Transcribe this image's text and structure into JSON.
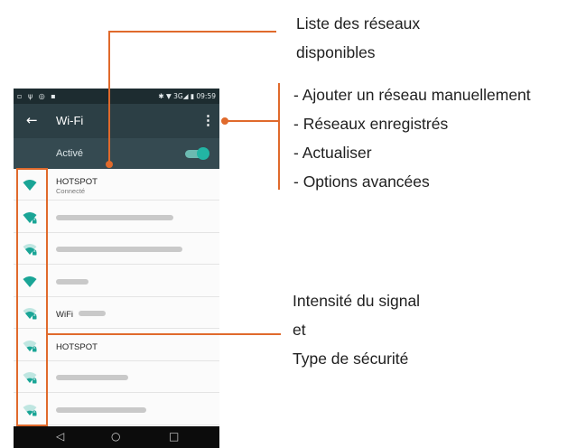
{
  "status_bar": {
    "left_icons": "▫ ψ ◎ ▪",
    "right": "✱ ▼ 3G◢ ▮ 09:59"
  },
  "app_bar": {
    "back_icon": "←",
    "title": "Wi-Fi",
    "menu_icon": "⋮"
  },
  "toggle_row": {
    "label": "Activé",
    "state": "on"
  },
  "networks": [
    {
      "name": "HOTSPOT",
      "sub": "Connecté",
      "signal": "full",
      "secured": false
    },
    {
      "name": "",
      "signal": "full",
      "secured": true
    },
    {
      "name": "",
      "signal": "medium",
      "secured": true
    },
    {
      "name": "",
      "signal": "full",
      "secured": false
    },
    {
      "name": "WiFi",
      "signal": "medium",
      "secured": true
    },
    {
      "name": "HOTSPOT",
      "signal": "weak",
      "secured": true
    },
    {
      "name": "",
      "signal": "weak",
      "secured": true
    },
    {
      "name": "",
      "signal": "weak",
      "secured": true
    }
  ],
  "nav_bar": {
    "back_icon": "◁",
    "home_icon": "○",
    "recents_icon": "□"
  },
  "callouts": {
    "network_list_line1": "Liste des réseaux",
    "network_list_line2": "disponibles",
    "menu_items": [
      "- Ajouter un réseau manuellement",
      "- Réseaux enregistrés",
      "- Actualiser",
      "- Options avancées"
    ],
    "signal_line1": "Intensité du signal",
    "signal_line2": "et",
    "signal_line3": "Type de sécurité"
  },
  "colors": {
    "accent_orange": "#e06a2c",
    "wifi_teal": "#1aa596",
    "appbar": "#2c3f45"
  }
}
